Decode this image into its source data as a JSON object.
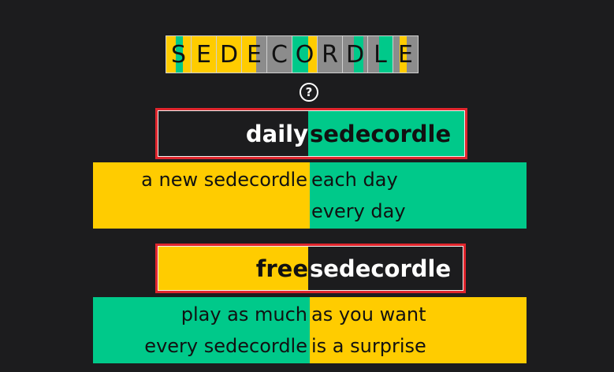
{
  "logo": {
    "letters": [
      "S",
      "E",
      "D",
      "E",
      "C",
      "O",
      "R",
      "D",
      "L",
      "E"
    ],
    "colors": {
      "yellow": "#ffcc00",
      "green": "#00c98a",
      "gray": "#8c8c8c"
    }
  },
  "help": {
    "icon": "question-circle-icon",
    "symbol": "?"
  },
  "daily": {
    "left": "daily",
    "right": "sedecordle",
    "desc_left": [
      "a new sedecordle",
      ""
    ],
    "desc_right": [
      "each day",
      "every day"
    ]
  },
  "free": {
    "left": "free",
    "right": "sedecordle",
    "desc_left": [
      "play as much",
      "every sedecordle"
    ],
    "desc_right": [
      "as you want",
      "is a surprise"
    ]
  },
  "theme": {
    "background": "#1c1c1e",
    "accent_border": "#e0262d",
    "yellow": "#ffcc00",
    "green": "#00c98a"
  }
}
